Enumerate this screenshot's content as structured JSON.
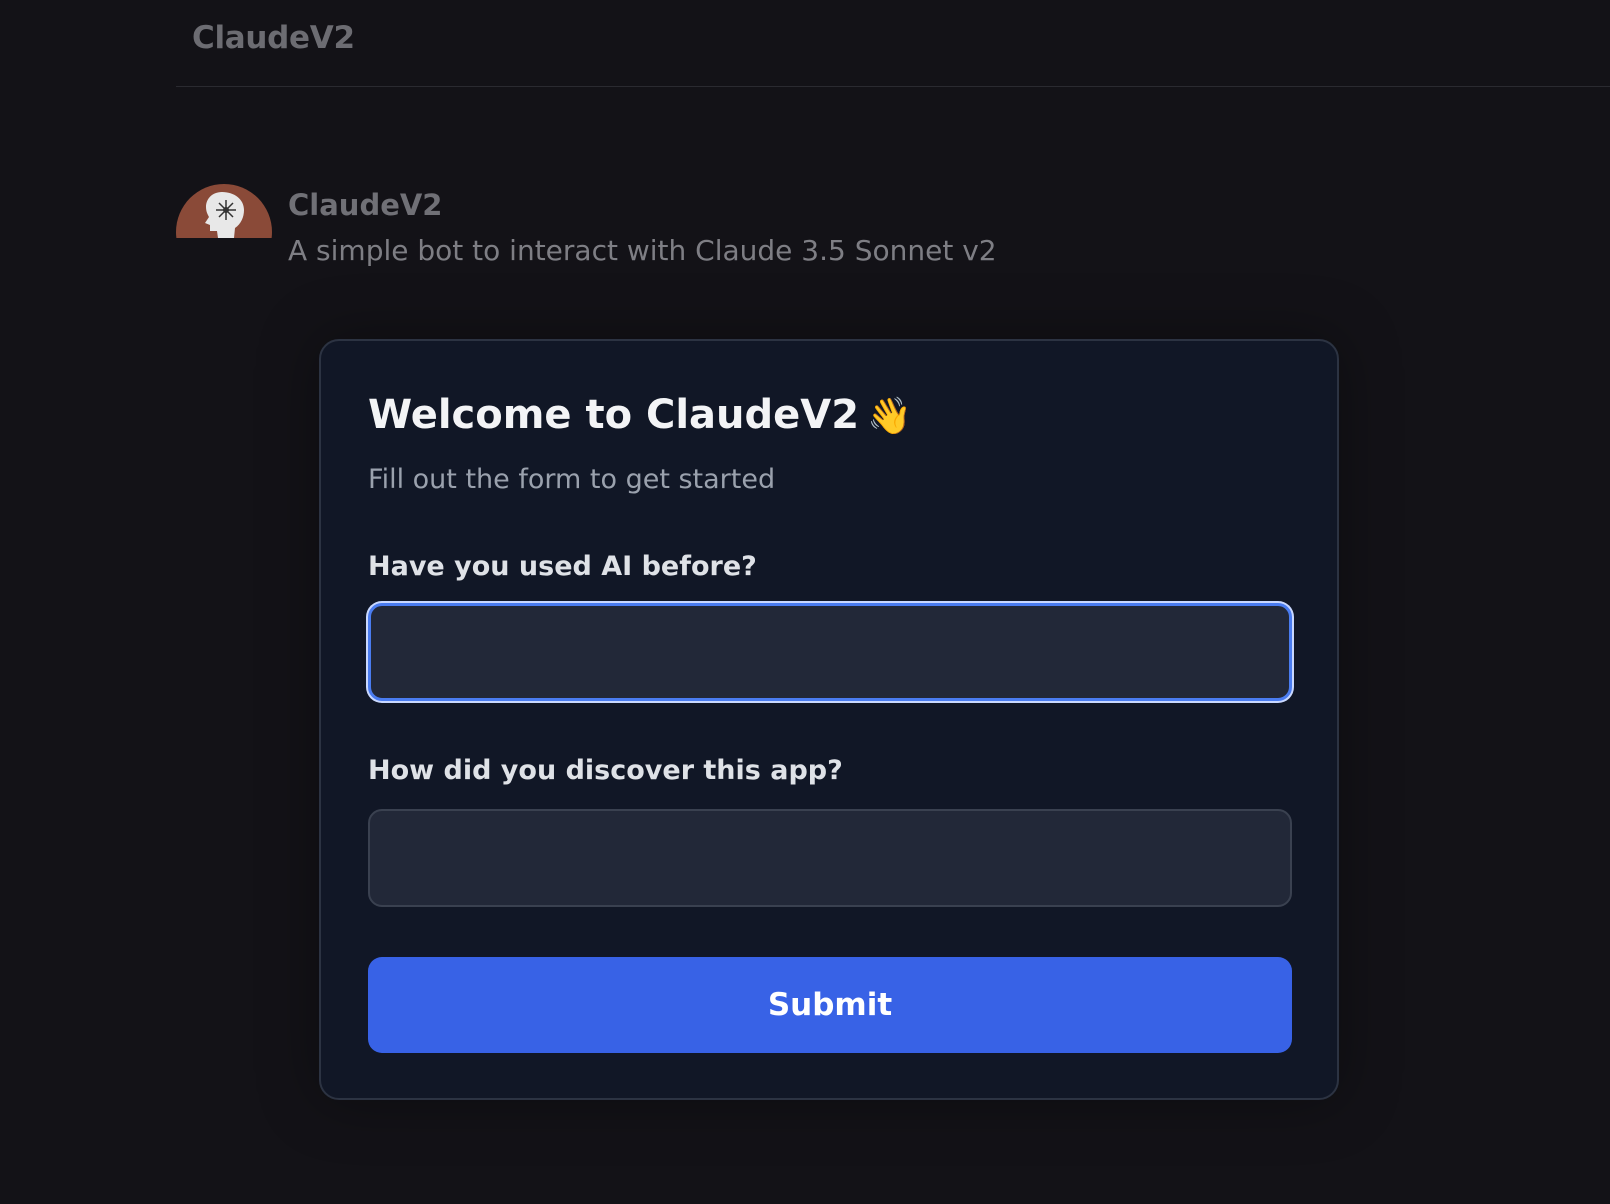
{
  "header": {
    "title": "ClaudeV2"
  },
  "bot": {
    "name": "ClaudeV2",
    "description": "A simple bot to interact with Claude 3.5 Sonnet v2",
    "avatar_icon": "head-silhouette-icon",
    "avatar_color": "#8a4a38"
  },
  "form": {
    "title": "Welcome to ClaudeV2",
    "title_emoji": "👋",
    "subtitle": "Fill out the form to get started",
    "fields": [
      {
        "label": "Have you used AI before?",
        "value": "",
        "focused": true
      },
      {
        "label": "How did you discover this app?",
        "value": ""
      }
    ],
    "submit_label": "Submit"
  },
  "colors": {
    "background": "#131217",
    "card": "#111726",
    "input": "#222838",
    "accent": "#3862e6",
    "focus_ring": "#4a7cf0"
  }
}
